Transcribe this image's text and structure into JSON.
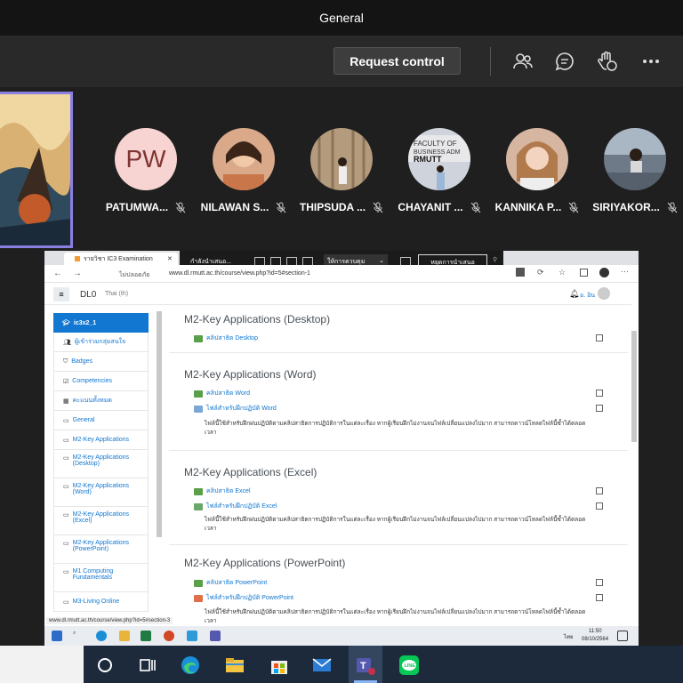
{
  "meeting": {
    "title": "General",
    "request_control_label": "Request control",
    "icons": [
      "people-icon",
      "chat-icon",
      "raise-hand-icon",
      "more-icon"
    ]
  },
  "participants": [
    {
      "name": "PATUMWA...",
      "initials": "PW",
      "avatar_color": "#f7d4d2",
      "initials_color": "#7f3532"
    },
    {
      "name": "NILAWAN S...",
      "avatar_color": "#d9a98a"
    },
    {
      "name": "THIPSUDA ...",
      "avatar_color": "#b49b7d"
    },
    {
      "name": "CHAYANIT ...",
      "avatar_color": "#cfd3dc"
    },
    {
      "name": "KANNIKA P...",
      "avatar_color": "#d6b6a0"
    },
    {
      "name": "SIRIYAKOR...",
      "avatar_color": "#6e7a88"
    }
  ],
  "browser": {
    "tab_title": "รายวิชา IC3 Examination",
    "address_prefix": "ไม่ปลอดภัย",
    "address": "www.dl.rmutt.ac.th/course/view.php?id=5#section-1",
    "status_url": "www.dl.rmutt.ac.th/course/view.php?id=5#section-3"
  },
  "presenter_bar": {
    "label": "กำลังนำเสนอ...",
    "control_label": "ให้การควบคุม",
    "stop_label": "หยุดการนำเสนอ"
  },
  "moodle": {
    "site": "DL0",
    "language": "Thai (th)",
    "user": "อ. อิน",
    "sidebar": {
      "active": "ic3x2_1",
      "items": [
        "ผู้เข้าร่วมกลุ่มสนใจ",
        "Badges",
        "Competencies",
        "คะแนนทั้งหมด",
        "General",
        "M2-Key Applications",
        "M2-Key Applications (Desktop)",
        "M2-Key Applications (Word)",
        "M2-Key Applications (Excel)",
        "M2-Key Applications (PowerPoint)",
        "M1 Computing Fundamentals",
        "M3-Living Online"
      ]
    },
    "sections": [
      {
        "title": "M2-Key Applications (Desktop)",
        "activities": [
          "คลิปสาธิต Desktop"
        ]
      },
      {
        "title": "M2-Key Applications (Word)",
        "activities": [
          "คลิปสาธิต Word",
          "ไฟล์สำหรับฝึกปฏิบัติ Word"
        ],
        "desc": "ไฟล์นี้ใช้สำหรับฝึกฝนปฏิบัติตามคลิปสาธิตการปฏิบัติการในแต่ละเรื่อง หากผู้เรียนฝึกไม่งานจนไฟล์เปลี่ยนแปลงไปมาก สามารถดาวน์โหลดไฟล์นี้ซ้ำได้ตลอดเวลา"
      },
      {
        "title": "M2-Key Applications (Excel)",
        "activities": [
          "คลิปสาธิต Excel",
          "ไฟล์สำหรับฝึกปฏิบัติ Excel"
        ],
        "desc": "ไฟล์นี้ใช้สำหรับฝึกฝนปฏิบัติตามคลิปสาธิตการปฏิบัติการในแต่ละเรื่อง หากผู้เรียนฝึกไม่งานจนไฟล์เปลี่ยนแปลงไปมาก สามารถดาวน์โหลดไฟล์นี้ซ้ำได้ตลอดเวลา"
      },
      {
        "title": "M2-Key Applications (PowerPoint)",
        "activities": [
          "คลิปสาธิต PowerPoint",
          "ไฟล์สำหรับฝึกปฏิบัติ PowerPoint"
        ],
        "desc": "ไฟล์นี้ใช้สำหรับฝึกฝนปฏิบัติตามคลิปสาธิตการปฏิบัติการในแต่ละเรื่อง หากผู้เรียนฝึกไม่งานจนไฟล์เปลี่ยนแปลงไปมาก สามารถดาวน์โหลดไฟล์นี้ซ้ำได้ตลอดเวลา"
      }
    ]
  },
  "remote_taskbar": {
    "time": "11:50",
    "date": "08/10/2564",
    "lang": "ไทย"
  }
}
